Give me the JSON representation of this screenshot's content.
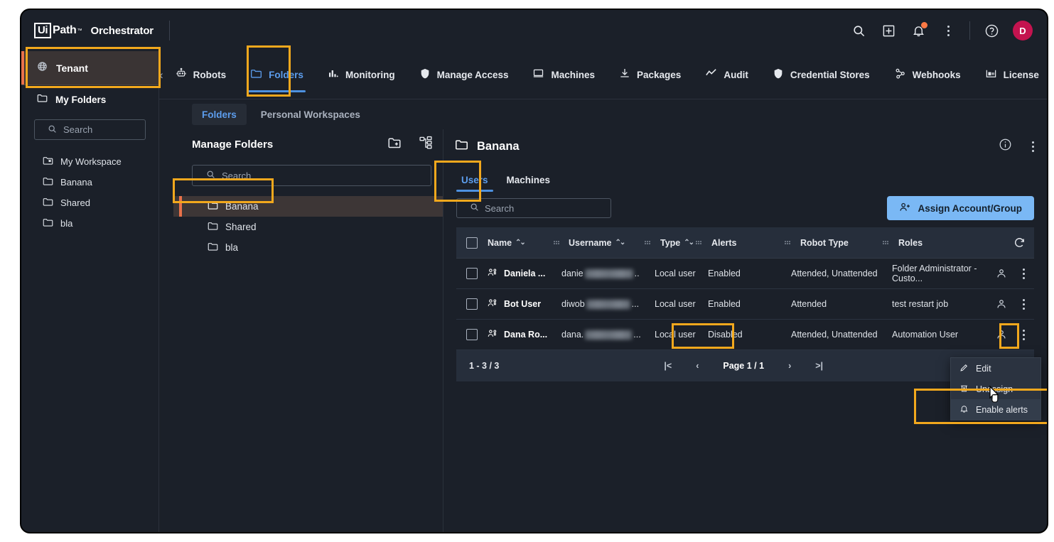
{
  "app": {
    "logo_ui": "Ui",
    "logo_path": "Path",
    "logo_tm": "™",
    "product": "Orchestrator"
  },
  "topbar": {
    "icons": [
      "search-icon",
      "apps-grid-icon",
      "notifications-bell-icon",
      "more-vertical-icon",
      "help-icon"
    ],
    "avatar_initial": "D"
  },
  "sidebar": {
    "tenant_label": "Tenant",
    "my_folders_label": "My Folders",
    "search_placeholder": "Search",
    "folders": [
      {
        "label": "My Workspace",
        "icon": "workspace-folder-icon"
      },
      {
        "label": "Banana",
        "icon": "folder-icon"
      },
      {
        "label": "Shared",
        "icon": "folder-icon"
      },
      {
        "label": "bla",
        "icon": "folder-icon"
      }
    ]
  },
  "nav": {
    "prev_label": "‹",
    "next_label": "›",
    "items": [
      {
        "label": "Robots",
        "icon": "robot-icon",
        "active": false
      },
      {
        "label": "Folders",
        "icon": "folder-icon",
        "active": true
      },
      {
        "label": "Monitoring",
        "icon": "bar-chart-icon",
        "active": false
      },
      {
        "label": "Manage Access",
        "icon": "shield-icon",
        "active": false
      },
      {
        "label": "Machines",
        "icon": "monitor-icon",
        "active": false
      },
      {
        "label": "Packages",
        "icon": "download-icon",
        "active": false
      },
      {
        "label": "Audit",
        "icon": "trend-line-icon",
        "active": false
      },
      {
        "label": "Credential Stores",
        "icon": "shield-icon",
        "active": false
      },
      {
        "label": "Webhooks",
        "icon": "webhook-icon",
        "active": false
      },
      {
        "label": "License",
        "icon": "license-icon",
        "active": false
      }
    ]
  },
  "subtabs": [
    {
      "label": "Folders",
      "active": true
    },
    {
      "label": "Personal Workspaces",
      "active": false
    }
  ],
  "manage_folders": {
    "title": "Manage Folders",
    "actions": [
      "add-folder-icon",
      "folder-hierarchy-icon"
    ],
    "search_placeholder": "Search",
    "items": [
      {
        "label": "Banana",
        "selected": true
      },
      {
        "label": "Shared",
        "selected": false
      },
      {
        "label": "bla",
        "selected": false
      }
    ]
  },
  "main": {
    "title": "Banana",
    "head_icons": [
      "info-icon",
      "more-vertical-icon"
    ],
    "tabs": [
      {
        "label": "Users",
        "active": true
      },
      {
        "label": "Machines",
        "active": false
      }
    ],
    "search_placeholder": "Search",
    "assign_button": "Assign Account/Group",
    "refresh_icon": "refresh-icon"
  },
  "table": {
    "columns": [
      {
        "label": "Name",
        "sortable": true
      },
      {
        "label": "Username",
        "sortable": true
      },
      {
        "label": "Type",
        "sortable": true
      },
      {
        "label": "Alerts",
        "sortable": false
      },
      {
        "label": "Robot Type",
        "sortable": false
      },
      {
        "label": "Roles",
        "sortable": false
      }
    ],
    "rows": [
      {
        "name": "Daniela ...",
        "username_prefix": "danie",
        "username_suffix": "..",
        "type": "Local user",
        "alerts": "Enabled",
        "robot_type": "Attended, Unattended",
        "roles": "Folder Administrator - Custo..."
      },
      {
        "name": "Bot User",
        "username_prefix": "diwob",
        "username_suffix": "...",
        "type": "Local user",
        "alerts": "Enabled",
        "robot_type": "Attended",
        "roles": "test restart job"
      },
      {
        "name": "Dana Ro...",
        "username_prefix": "dana.",
        "username_suffix": "...",
        "type": "Local user",
        "alerts": "Disabled",
        "robot_type": "Attended, Unattended",
        "roles": "Automation User"
      }
    ]
  },
  "pagination": {
    "range": "1 - 3 / 3",
    "first": "|<",
    "prev": "‹",
    "page": "Page 1 / 1",
    "next": "›",
    "last": ">|"
  },
  "context_menu": [
    {
      "label": "Edit",
      "icon": "pencil-icon",
      "hover": false
    },
    {
      "label": "Unassign",
      "icon": "trash-icon",
      "hover": false
    },
    {
      "label": "Enable alerts",
      "icon": "bell-icon",
      "hover": true
    }
  ],
  "colors": {
    "highlight": "#f2a81d",
    "accent_blue": "#5c9ded",
    "accent_orange": "#e8714a",
    "button_blue": "#7ab8f5",
    "avatar_pink": "#c4134f",
    "background": "#1b2029",
    "panel_header": "#262e3b"
  }
}
